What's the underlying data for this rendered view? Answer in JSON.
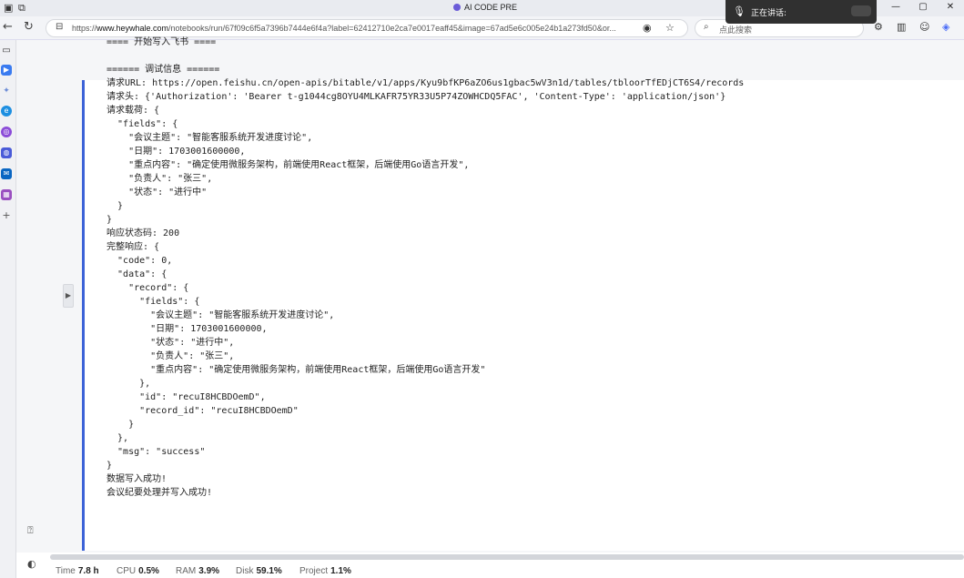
{
  "browser": {
    "tab_title": "AI CODE PRE",
    "url_prefix": "https://",
    "url_host": "www.heywhale.com",
    "url_rest": "/notebooks/run/67f09c6f5a7396b7444e6f4a?label=62412710e2ca7e0017eaff45&image=67ad5e6c005e24b1a273fd50&or...",
    "search_placeholder": "点此搜索",
    "min_glyph": "—",
    "max_glyph": "▢",
    "close_glyph": "✕"
  },
  "speaking_popup": {
    "text": "正在讲话:"
  },
  "output_lines": [
    "==== 开始写入飞书 ====",
    "",
    "====== 调试信息 ======",
    "请求URL: https://open.feishu.cn/open-apis/bitable/v1/apps/Kyu9bfKP6aZO6us1gbac5wV3n1d/tables/tbloorTfEDjCT6S4/records",
    "请求头: {'Authorization': 'Bearer t-g1044cg8OYU4MLKAFR75YR33U5P74ZOWHCDQ5FAC', 'Content-Type': 'application/json'}",
    "请求载荷: {",
    "  \"fields\": {",
    "    \"会议主题\": \"智能客服系统开发进度讨论\",",
    "    \"日期\": 1703001600000,",
    "    \"重点内容\": \"确定使用微服务架构，前端使用React框架，后端使用Go语言开发\",",
    "    \"负责人\": \"张三\",",
    "    \"状态\": \"进行中\"",
    "  }",
    "}",
    "响应状态码: 200",
    "完整响应: {",
    "  \"code\": 0,",
    "  \"data\": {",
    "    \"record\": {",
    "      \"fields\": {",
    "        \"会议主题\": \"智能客服系统开发进度讨论\",",
    "        \"日期\": 1703001600000,",
    "        \"状态\": \"进行中\",",
    "        \"负责人\": \"张三\",",
    "        \"重点内容\": \"确定使用微服务架构，前端使用React框架，后端使用Go语言开发\"",
    "      },",
    "      \"id\": \"recuI8HCBDOemD\",",
    "      \"record_id\": \"recuI8HCBDOemD\"",
    "    }",
    "  },",
    "  \"msg\": \"success\"",
    "}",
    "数据写入成功!",
    "会议纪要处理并写入成功!"
  ],
  "status_bar": [
    {
      "label": "Time",
      "value": "7.8 h"
    },
    {
      "label": "CPU",
      "value": "0.5%"
    },
    {
      "label": "RAM",
      "value": "3.9%"
    },
    {
      "label": "Disk",
      "value": "59.1%"
    },
    {
      "label": "Project",
      "value": "1.1%"
    }
  ],
  "colors": {
    "cell_accent": "#3c62d7",
    "tab_icon": "#6b5bd8"
  }
}
